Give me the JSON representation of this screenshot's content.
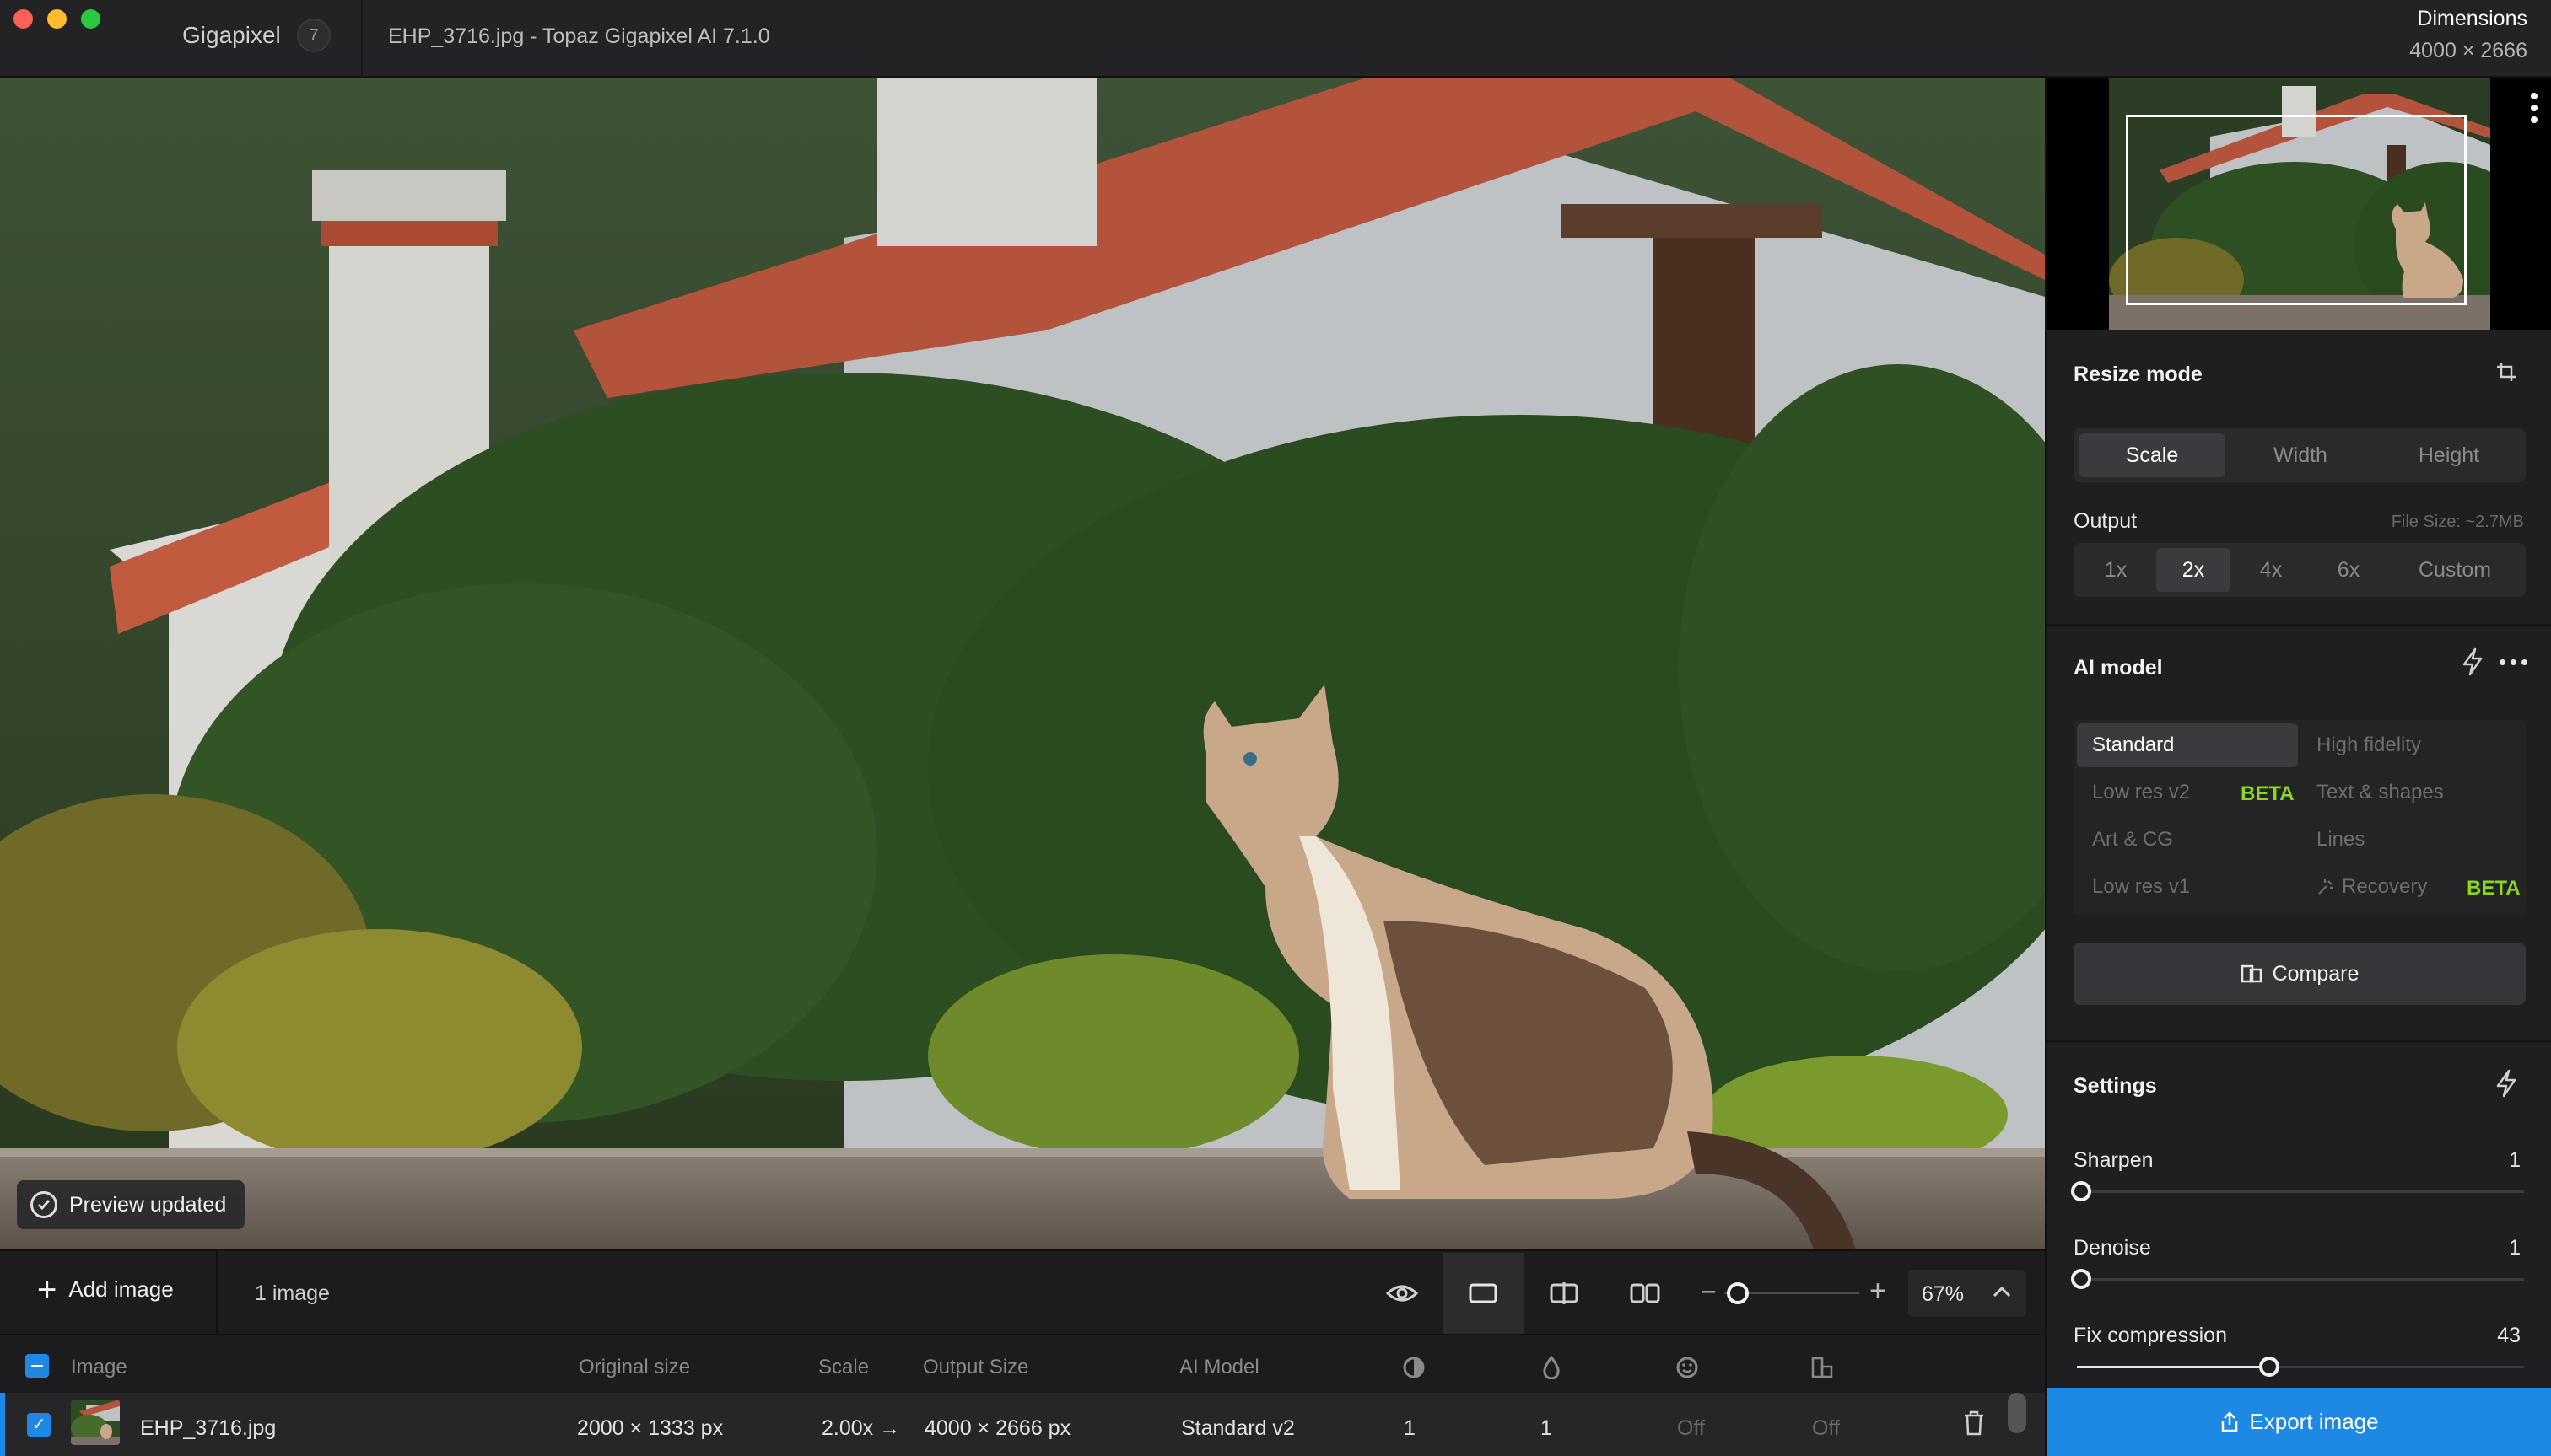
{
  "titlebar": {
    "app_name": "Gigapixel",
    "badge": "7",
    "window_title": "EHP_3716.jpg - Topaz Gigapixel AI 7.1.0",
    "dimensions_label": "Dimensions",
    "dimensions_value": "4000 × 2666"
  },
  "canvas": {
    "toast": "Preview updated"
  },
  "toolbar": {
    "add_label": "Add image",
    "image_count": "1 image",
    "zoom_percent": "67%",
    "zoom_level": 0.1
  },
  "table": {
    "headers": {
      "image": "Image",
      "original_size": "Original size",
      "scale": "Scale",
      "output_size": "Output Size",
      "ai_model": "AI Model"
    },
    "row": {
      "name": "EHP_3716.jpg",
      "original_size": "2000 × 1333 px",
      "scale": "2.00x →",
      "output_size": "4000 × 2666 px",
      "ai_model": "Standard v2",
      "sharpen": "1",
      "denoise": "1",
      "face": "Off",
      "text": "Off"
    }
  },
  "panel": {
    "resize_mode": {
      "title": "Resize mode",
      "tabs": [
        "Scale",
        "Width",
        "Height"
      ],
      "active": "Scale",
      "output_label": "Output",
      "file_size": "File Size: ~2.7MB",
      "outputs": [
        "1x",
        "2x",
        "4x",
        "6x",
        "Custom"
      ],
      "active_output": "2x"
    },
    "ai_model": {
      "title": "AI model",
      "left": [
        "Standard",
        "Low res v2",
        "Art & CG",
        "Low res v1"
      ],
      "right": [
        "High fidelity",
        "Text & shapes",
        "Lines",
        "Recovery"
      ],
      "active": "Standard",
      "beta": "BETA",
      "compare": "Compare"
    },
    "settings": {
      "title": "Settings",
      "sharpen_label": "Sharpen",
      "sharpen_value": "1",
      "sharpen_level": 0.01,
      "denoise_label": "Denoise",
      "denoise_value": "1",
      "denoise_level": 0.01,
      "fix_label": "Fix compression",
      "fix_value": "43",
      "fix_level": 0.43
    },
    "export": "Export image"
  }
}
